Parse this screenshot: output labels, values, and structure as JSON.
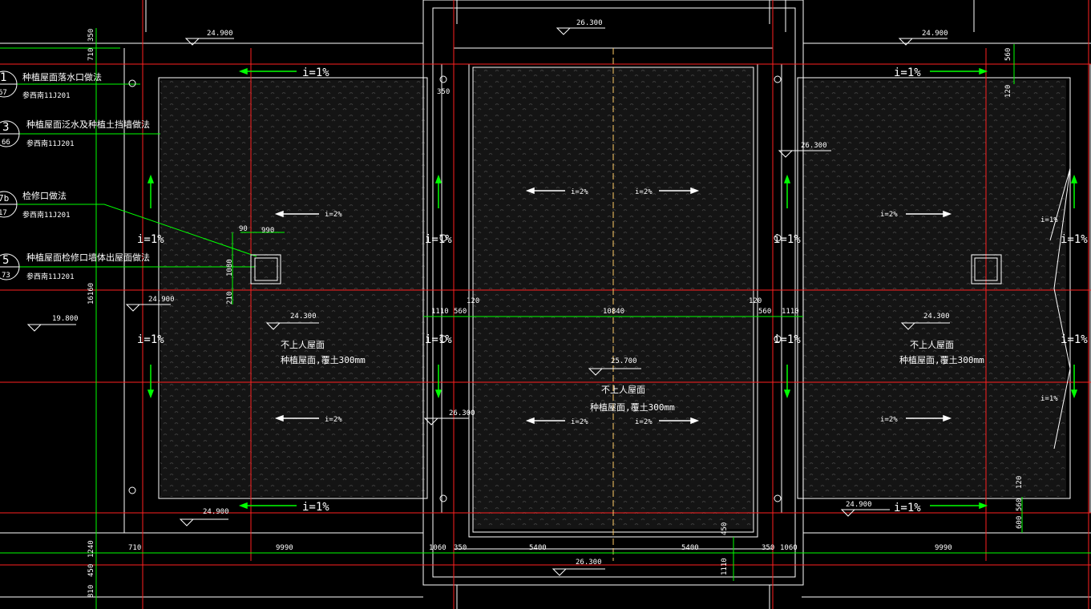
{
  "colors": {
    "background": "#000000",
    "outline": "#ffffff",
    "axis": "#ff2020",
    "dimension": "#00ff00",
    "hatch": "#2a2a2a",
    "center_line": "#ffcc66"
  },
  "elevations": {
    "left_top": "24.900",
    "mid_top": "26.300",
    "right_top": "24.900",
    "right_upper": "26.300",
    "left_mid_a": "24.900",
    "left_mid_b": "24.300",
    "left_low": "19.800",
    "right_mid": "24.300",
    "mid_center": "25.700",
    "mid_left": "26.300",
    "left_bottom": "24.900",
    "right_bottom": "24.900",
    "mid_bottom": "26.300"
  },
  "slopes": {
    "one_pct": "i=1%",
    "two_pct": "i=2%"
  },
  "notes": {
    "not_accessible": "不上人屋面",
    "planted_roof": "种植屋面,覆土300mm"
  },
  "callouts": [
    {
      "num": "1",
      "sub": "67",
      "title": "种植屋面落水口做法",
      "ref": "参西南11J201"
    },
    {
      "num": "3",
      "sub": "66",
      "title": "种植屋面泛水及种植土挡墙做法",
      "ref": "参西南11J201"
    },
    {
      "num": "7b",
      "sub": "17",
      "title": "检修口做法",
      "ref": "参西南11J201"
    },
    {
      "num": "5",
      "sub": "73",
      "title": "种植屋面检修口墙体出屋面做法",
      "ref": "参西南11J201"
    }
  ],
  "dimensions": {
    "bottom_row": [
      "710",
      "9990",
      "1060",
      "350",
      "5400",
      "5400",
      "350",
      "1060",
      "9990"
    ],
    "mid_row": [
      "1110",
      "560",
      "120",
      "10840",
      "120",
      "560",
      "1110"
    ],
    "left_col": [
      "350",
      "710",
      "16160",
      "1240",
      "450",
      "810"
    ],
    "right_col": [
      "560",
      "120",
      "120",
      "560",
      "600"
    ],
    "hatch_dims": [
      "90",
      "990",
      "1080",
      "210"
    ],
    "misc": [
      "350",
      "450",
      "1110"
    ]
  }
}
